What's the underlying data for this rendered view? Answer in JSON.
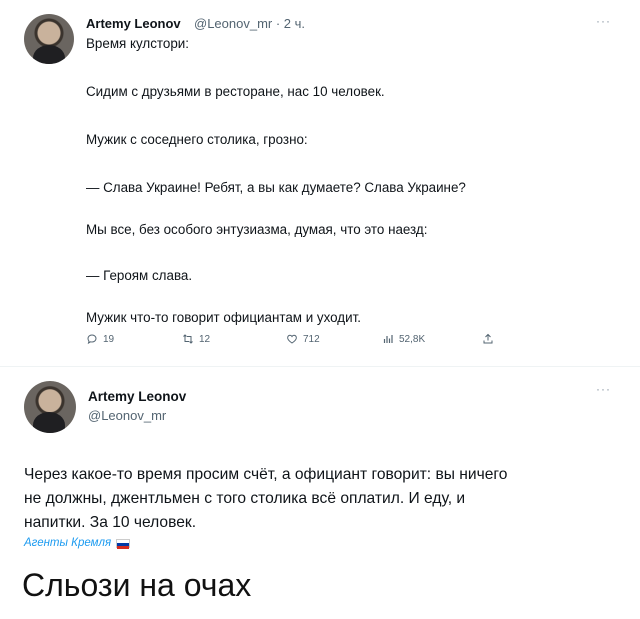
{
  "tweet1": {
    "author_name": "Artemy Leonov",
    "handle_time": "@Leonov_mr · 2 ч.",
    "more": "···",
    "lines": [
      "Время кулстори:",
      "Сидим с друзьями в ресторане, нас 10 человек.",
      "Мужик с соседнего столика, грозно:",
      "— Слава Украине! Ребят, а вы как думаете? Слава Украине?",
      "Мы все, без особого энтузиазма, думая, что это наезд:",
      "— Героям слава.",
      "Мужик что-то говорит официантам и уходит."
    ],
    "actions": {
      "replies": "19",
      "retweets": "12",
      "likes": "712",
      "views": "52,8K"
    },
    "icons": [
      "reply-icon",
      "retweet-icon",
      "like-icon",
      "views-icon",
      "share-icon"
    ]
  },
  "tweet2": {
    "author_name": "Artemy Leonov",
    "handle": "@Leonov_mr",
    "more": "···",
    "lines": [
      "Через какое-то время просим счёт, а официант говорит: вы ничего",
      "не должны, джентльмен с того столика всё оплатил. И еду, и",
      "напитки. За 10 человек."
    ]
  },
  "overlay": {
    "agents_label": "Агенты Кремля",
    "flag_colors": [
      "#ffffff",
      "#0039a6",
      "#d52b1e"
    ],
    "caption": "Сльози на очах"
  },
  "colors": {
    "text": "#0f1419",
    "muted": "#536471",
    "accent": "#1d9bf0"
  }
}
